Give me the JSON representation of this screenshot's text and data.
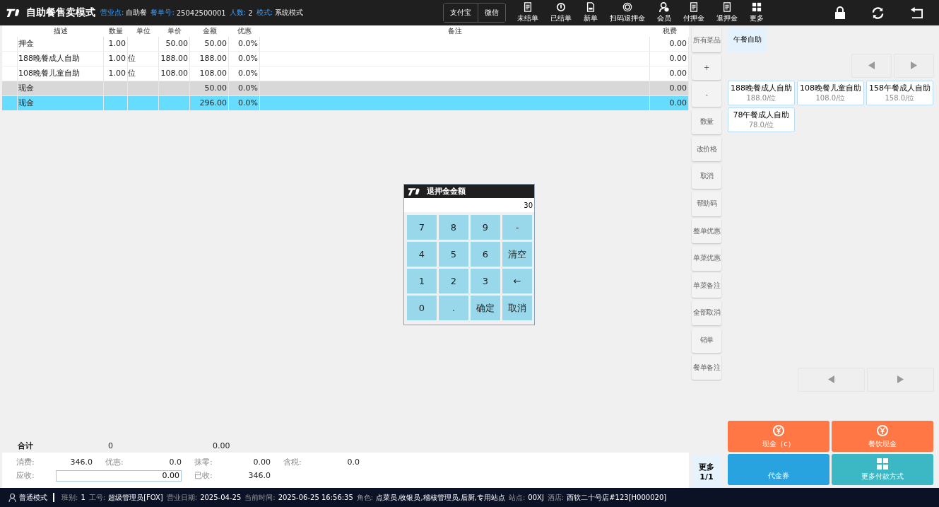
{
  "top_bar": {
    "title": "自助餐售卖模式",
    "info": [
      {
        "label": "营业点:",
        "value": "自助餐"
      },
      {
        "label": "餐单号:",
        "value": "25042500001"
      },
      {
        "label": "人数:",
        "value": "2"
      },
      {
        "label": "模式:",
        "value": "系统模式"
      }
    ],
    "pay_toggles": [
      {
        "label": "支付宝"
      },
      {
        "label": "微信"
      }
    ],
    "tools": [
      {
        "label": "未结单"
      },
      {
        "label": "已结单"
      },
      {
        "label": "新单"
      },
      {
        "label": "扫码退押金"
      },
      {
        "label": "会员"
      },
      {
        "label": "付押金"
      },
      {
        "label": "退押金"
      },
      {
        "label": "更多"
      }
    ]
  },
  "table": {
    "columns": [
      "描述",
      "数量",
      "单位",
      "单价",
      "金额",
      "优惠",
      "备注",
      "税费"
    ],
    "rows": [
      {
        "kind": "item",
        "selected": false,
        "cells": [
          "押金",
          "1.00",
          "",
          "50.00",
          "50.00",
          "0.0%",
          "",
          "0.00"
        ]
      },
      {
        "kind": "item",
        "selected": false,
        "cells": [
          "188晚餐成人自助",
          "1.00",
          "位",
          "188.00",
          "188.00",
          "0.0%",
          "",
          "0.00"
        ]
      },
      {
        "kind": "item",
        "selected": false,
        "cells": [
          "108晚餐儿童自助",
          "1.00",
          "位",
          "108.00",
          "108.00",
          "0.0%",
          "",
          "0.00"
        ]
      },
      {
        "kind": "payment",
        "selected": false,
        "cells": [
          "现金",
          "",
          "",
          "",
          "50.00",
          "0.0%",
          "",
          "0.00"
        ]
      },
      {
        "kind": "payment",
        "selected": true,
        "cells": [
          "现金",
          "",
          "",
          "",
          "296.00",
          "0.0%",
          "",
          "0.00"
        ]
      }
    ]
  },
  "totals": {
    "label": "合计",
    "quantity": "0",
    "amount": "0.00"
  },
  "summary": {
    "fields": [
      {
        "label": "消费:",
        "value": "346.0",
        "kind": "text"
      },
      {
        "label": "优惠:",
        "value": "0.0",
        "kind": "text"
      },
      {
        "label": "抹零:",
        "value": "0.00",
        "kind": "text"
      },
      {
        "label": "含税:",
        "value": "0.0",
        "kind": "text"
      },
      {
        "label": "应收:",
        "value": "0.00",
        "kind": "field"
      },
      {
        "label": "已收:",
        "value": "346.0",
        "kind": "text"
      }
    ]
  },
  "dialog": {
    "title": "退押金金额",
    "value": "30",
    "keys": [
      "7",
      "8",
      "9",
      "-",
      "4",
      "5",
      "6",
      "清空",
      "1",
      "2",
      "3",
      "←",
      "0",
      ".",
      "确定",
      "取消"
    ]
  },
  "side_buttons": [
    "所有菜品",
    "+",
    "-",
    "数量",
    "改价格",
    "取消",
    "帮助码",
    "整单优惠",
    "单菜优惠",
    "单菜备注",
    "全部取消",
    "销单",
    "餐单备注"
  ],
  "categories": [
    {
      "label": "午餐自助",
      "selected": true
    }
  ],
  "products": [
    {
      "name": "188晚餐成人自助",
      "price": "188.0/位"
    },
    {
      "name": "108晚餐儿童自助",
      "price": "108.0/位"
    },
    {
      "name": "158午餐成人自助",
      "price": "158.0/位"
    },
    {
      "name": "78午餐成人自助",
      "price": "78.0/位"
    }
  ],
  "more_button": {
    "label": "更多",
    "page": "1/1"
  },
  "payments": [
    {
      "label": "现金（c）",
      "color": "#ff7744",
      "kind": "coin"
    },
    {
      "label": "餐饮现金",
      "color": "#ff7744",
      "kind": "coin"
    },
    {
      "label": "代金券",
      "color": "#29a3df",
      "kind": "plain"
    },
    {
      "label": "更多付款方式",
      "color": "#3bb8c3",
      "kind": "grid"
    }
  ],
  "status_bar": {
    "mode": "普通模式",
    "fields": [
      {
        "label": "班别:",
        "value": "1"
      },
      {
        "label": "工号:",
        "value": "超级管理员[FOX]"
      },
      {
        "label": "营业日期:",
        "value": "2025-04-25"
      },
      {
        "label": "当前时间:",
        "value": "2025-06-25 16:56:35"
      },
      {
        "label": "角色:",
        "value": "点菜员,收银员,稽核管理员,后厨,专用站点"
      },
      {
        "label": "站点:",
        "value": "00XJ"
      },
      {
        "label": "酒店:",
        "value": "西软二十号店#123[H000020]"
      }
    ]
  }
}
